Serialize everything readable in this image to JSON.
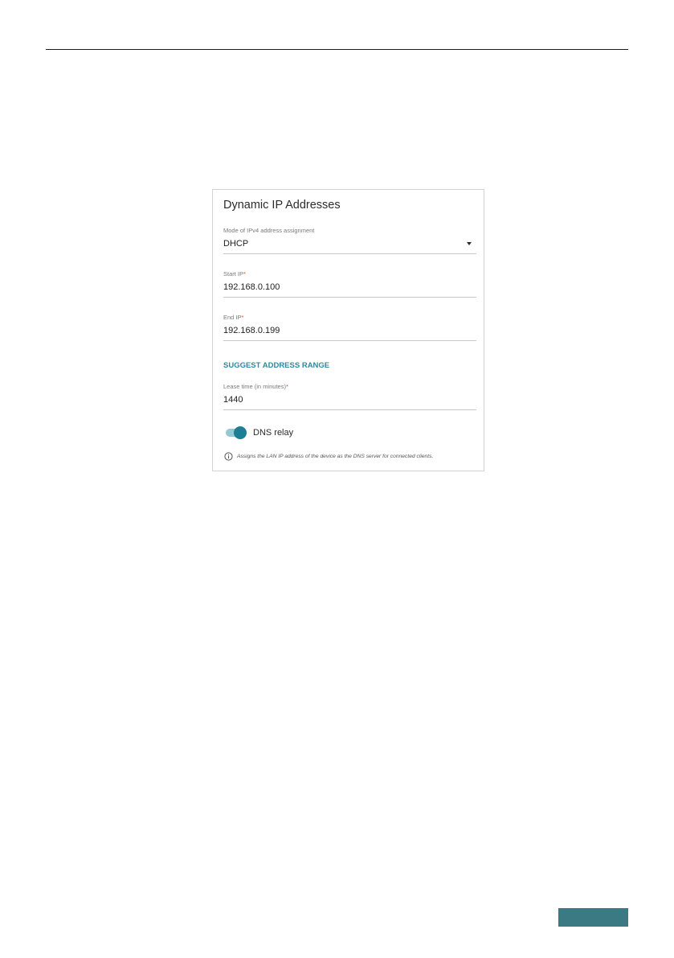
{
  "card": {
    "title": "Dynamic IP Addresses",
    "mode": {
      "label": "Mode of IPv4 address assignment",
      "value": "DHCP"
    },
    "start_ip": {
      "label": "Start IP",
      "required": "*",
      "value": "192.168.0.100"
    },
    "end_ip": {
      "label": "End IP",
      "required": "*",
      "value": "192.168.0.199"
    },
    "suggest_label": "SUGGEST ADDRESS RANGE",
    "lease_time": {
      "label": "Lease time (in minutes)",
      "required": "*",
      "value": "1440"
    },
    "dns_relay": {
      "label": "DNS relay",
      "enabled": true,
      "hint": "Assigns the LAN IP address of the device as the DNS server for connected clients."
    }
  },
  "colors": {
    "accent": "#1d7f96",
    "link": "#2a8aa0",
    "required": "#e04a2a",
    "footer_tab": "#3c7a83"
  },
  "icons": {
    "dropdown": "chevron-down-icon",
    "info": "info-icon"
  }
}
